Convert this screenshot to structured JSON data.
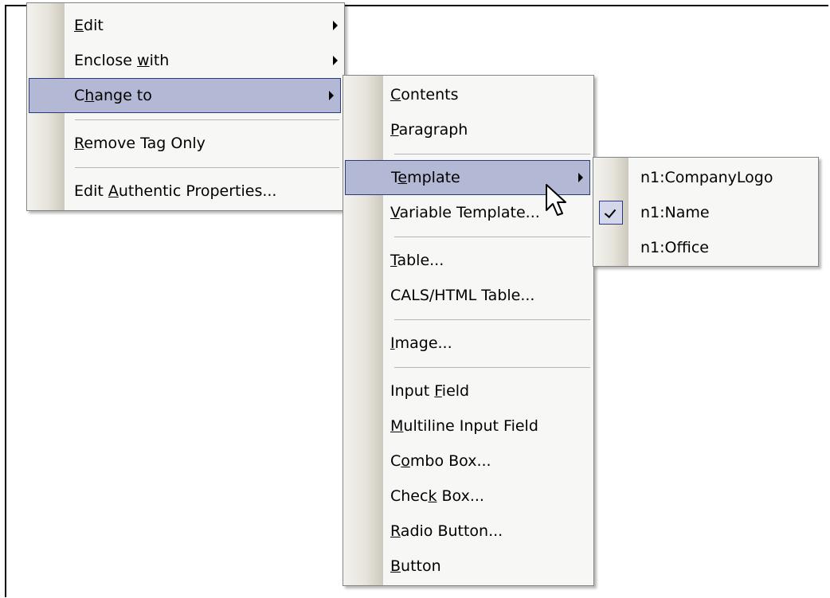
{
  "menu1": {
    "items": [
      {
        "pre": "",
        "key": "E",
        "post": "dit",
        "submenu": true
      },
      {
        "pre": "Enclose ",
        "key": "w",
        "post": "ith",
        "submenu": true
      },
      {
        "pre": "C",
        "key": "h",
        "post": "ange to",
        "submenu": true,
        "highlighted": true
      },
      {
        "pre": "",
        "key": "R",
        "post": "emove Tag Only",
        "submenu": false
      },
      {
        "pre": "Edit ",
        "key": "A",
        "post": "uthentic Properties...",
        "submenu": false
      }
    ]
  },
  "menu2": {
    "items": [
      {
        "pre": "",
        "key": "C",
        "post": "ontents"
      },
      {
        "pre": "",
        "key": "P",
        "post": "aragraph"
      },
      {
        "pre": "T",
        "key": "e",
        "post": "mplate",
        "submenu": true,
        "highlighted": true
      },
      {
        "pre": "",
        "key": "V",
        "post": "ariable Template..."
      },
      {
        "pre": "",
        "key": "T",
        "post": "able..."
      },
      {
        "pre": "CALS/HTML Table...",
        "key": "",
        "post": ""
      },
      {
        "pre": "",
        "key": "I",
        "post": "mage..."
      },
      {
        "pre": "Input ",
        "key": "F",
        "post": "ield"
      },
      {
        "pre": "",
        "key": "M",
        "post": "ultiline Input Field"
      },
      {
        "pre": "C",
        "key": "o",
        "post": "mbo Box..."
      },
      {
        "pre": "Chec",
        "key": "k",
        "post": " Box..."
      },
      {
        "pre": "",
        "key": "R",
        "post": "adio Button..."
      },
      {
        "pre": "",
        "key": "B",
        "post": "utton"
      }
    ]
  },
  "menu3": {
    "items": [
      {
        "label": "n1:CompanyLogo",
        "checked": false
      },
      {
        "label": "n1:Name",
        "checked": true
      },
      {
        "label": "n1:Office",
        "checked": false
      }
    ]
  },
  "colors": {
    "highlight_bg": "#b3b8d4",
    "highlight_border": "#2a3a80",
    "menu_bg": "#f7f7f5"
  }
}
